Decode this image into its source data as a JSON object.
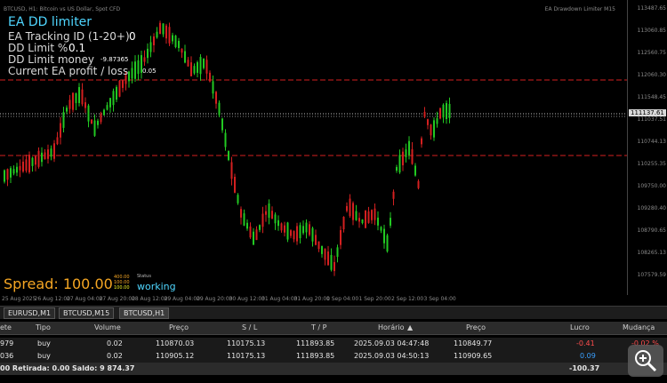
{
  "chart": {
    "symbol_title": "BTCUSD, H1: Bitcoin vs US Dollar, Spot CFD",
    "ea_title": "EA Drawdown Limiter M15",
    "price_labels": [
      "113487.65",
      "113060.85",
      "112560.75",
      "112060.30",
      "111548.45",
      "111037.51",
      "110744.13",
      "110255.35",
      "109750.00",
      "109280.40",
      "108790.65",
      "108265.13",
      "107579.59"
    ],
    "current_price": "111137.61",
    "time_labels": [
      "25 Aug 2025",
      "26 Aug 12:00",
      "27 Aug 04:00",
      "27 Aug 20:00",
      "28 Aug 12:00",
      "29 Aug 04:00",
      "29 Aug 20:00",
      "30 Aug 12:00",
      "31 Aug 04:00",
      "31 Aug 20:00",
      "1 Sep 04:00",
      "1 Sep 20:00",
      "2 Sep 12:00",
      "3 Sep 04:00"
    ],
    "colors": {
      "bull": "#22c922",
      "bear": "#d42020",
      "level": "#d42020",
      "panel": "#4fd6ff",
      "spread": "#f5a623"
    }
  },
  "ea_panel": {
    "name": "EA DD limiter",
    "tracking_label": "EA Tracking ID (1-20+)",
    "tracking_value": "0",
    "dd_limit_pct_label": "DD Limit %",
    "dd_limit_pct_value": "0.1",
    "dd_limit_money_label": "DD Limit money",
    "dd_limit_money_value": "-9.87365",
    "profit_label": "Current EA profit / loss",
    "profit_value": "0.05",
    "spread_text": "Spread: 100.00",
    "mini": [
      "400.00",
      "100.00",
      "100.00"
    ],
    "status_label": "Status",
    "status_value": "working"
  },
  "tabs": [
    "EURUSD,M1",
    "BTCUSD,M15",
    "BTCUSD,H1"
  ],
  "terminal": {
    "headers": [
      "ete",
      "Tipo",
      "Volume",
      "Preço",
      "S / L",
      "T / P",
      "Horário",
      "Preço",
      "Lucro",
      "Mudança"
    ],
    "rows": [
      {
        "id": "979",
        "type": "buy",
        "volume": "0.02",
        "open": "110870.03",
        "sl": "110175.13",
        "tp": "111893.85",
        "time": "2025.09.03 04:47:48",
        "price": "110849.77",
        "profit": "-0.41",
        "change": "-0.02 %"
      },
      {
        "id": "036",
        "type": "buy",
        "volume": "0.02",
        "open": "110905.12",
        "sl": "110175.13",
        "tp": "111893.85",
        "time": "2025.09.03 04:50:13",
        "price": "110909.65",
        "profit": "0.09",
        "change": ""
      }
    ],
    "summary": "00  Retirada: 0.00  Saldo: 9 874.37",
    "summary_total": "-100.37"
  }
}
